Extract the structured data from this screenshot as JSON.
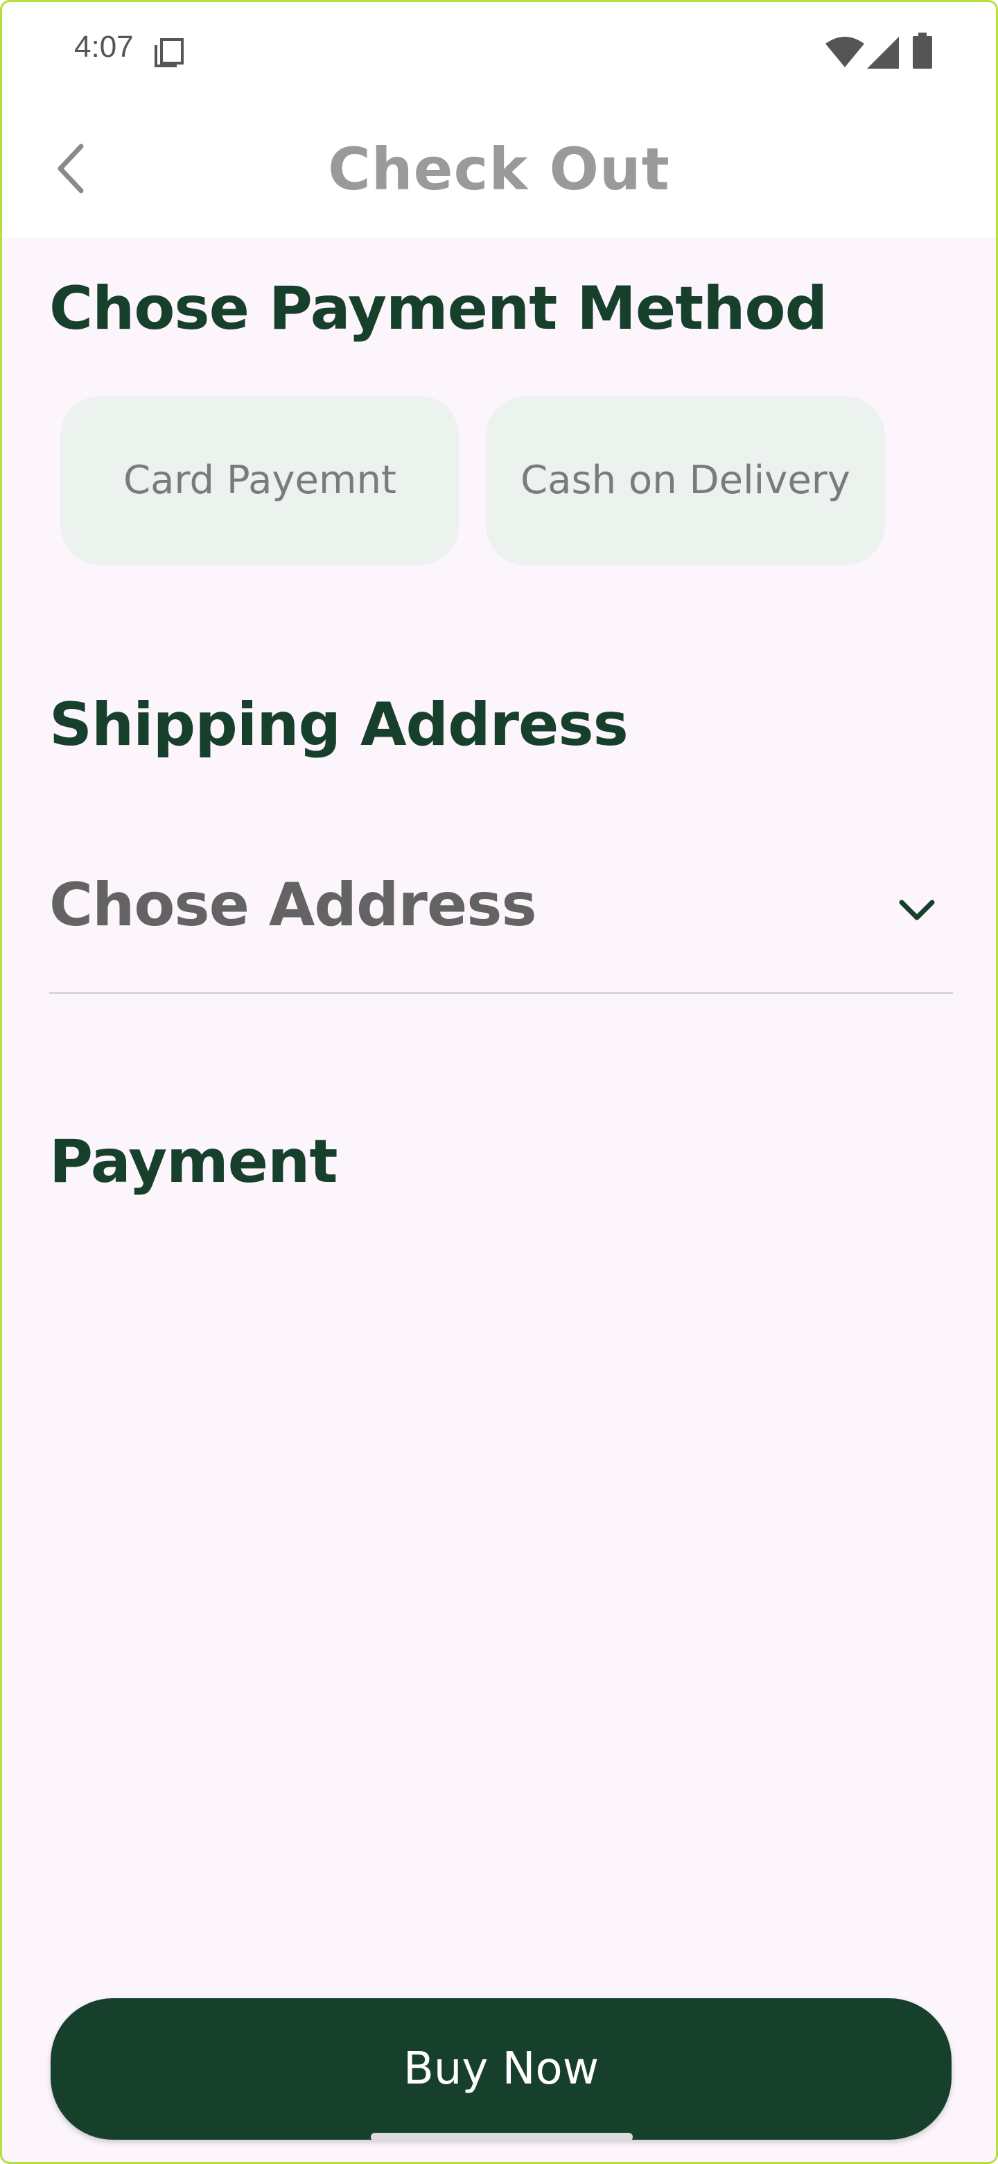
{
  "status_bar": {
    "time": "4:07",
    "icons": [
      "screenshot-icon",
      "wifi-icon",
      "cellular-signal-icon",
      "battery-icon"
    ]
  },
  "app_bar": {
    "back_icon": "chevron-left-icon",
    "title": "Check Out"
  },
  "payment_method": {
    "heading": "Chose Payment Method",
    "options": [
      {
        "label": "Card Payemnt"
      },
      {
        "label": "Cash on Delivery"
      }
    ]
  },
  "shipping": {
    "heading": "Shipping Address",
    "dropdown_value": "Chose Address",
    "dropdown_icon": "chevron-down-icon"
  },
  "payment": {
    "heading": "Payment"
  },
  "footer": {
    "buy_now_label": "Buy Now"
  },
  "colors": {
    "primary": "#17402c",
    "background": "#fcf5fc",
    "option_bg": "#ecf3ef",
    "title_gray": "#9a9a9a"
  }
}
